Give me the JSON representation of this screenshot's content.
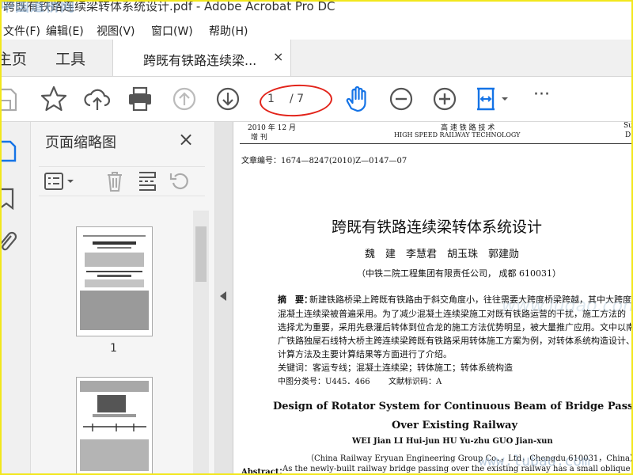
{
  "window": {
    "title": "跨既有铁路连续梁转体系统设计.pdf - Adobe Acrobat Pro DC"
  },
  "watermarks": {
    "top_left": "中国道桥网",
    "bottom_right": "www.lubao.com",
    "middle": "www.ludao.com"
  },
  "menu": [
    "文件(F)",
    "编辑(E)",
    "视图(V)",
    "窗口(W)",
    "帮助(H)"
  ],
  "tabs": {
    "home": "主页",
    "tools": "工具",
    "document": "跨既有铁路连续梁...",
    "close": "×"
  },
  "toolbar": {
    "page_current": "1",
    "page_total": "/ 7",
    "more": "···"
  },
  "thumbnails": {
    "header": "页面缩略图",
    "close": "×",
    "page1_label": "1"
  },
  "document": {
    "header_left_1": "2010 年 12 月",
    "header_left_2": "增  刊",
    "header_center_1": "高  速  铁  路  技  术",
    "header_center_2": "HIGH SPEED RAILWAY TECHNOLOGY",
    "header_right_1": "Su",
    "header_right_2": "D",
    "article_no": "文章编号：1674—8247(2010)Z—0147—07",
    "title_cn": "跨既有铁路连续梁转体系统设计",
    "authors_cn": "魏　建　李慧君　胡玉珠　郭建勋",
    "affiliation_cn": "（中铁二院工程集团有限责任公司，  成都 610031）",
    "abstract_label": "摘　要：",
    "abstract_lines": [
      "新建铁路桥梁上跨既有铁路由于斜交角度小，往往需要大跨度桥梁跨越，其中大跨度",
      "混凝土连续梁被普遍采用。为了减少混凝土连续梁施工对既有铁路运营的干扰，施工方法的",
      "选择尤为重要，采用先悬灌后转体到位合龙的施工方法优势明显，被大量推广应用。文中以南",
      "广铁路独屋石线特大桥主跨连续梁跨既有铁路采用转体施工方案为例，对转体系统构造设计、",
      "计算方法及主要计算结果等方面进行了介绍。"
    ],
    "keywords": "关键词：客运专线；混凝土连续梁；转体施工；转体系统构造",
    "clc": "中图分类号：U445．466",
    "doc_code": "文献标识码：A",
    "title_en_1": "Design of Rotator System for Continuous Beam of Bridge Passing",
    "title_en_2": "Over Existing Railway",
    "authors_en": "WEI Jian   LI Hui-jun   HU Yu-zhu   GUO Jian-xun",
    "affiliation_en": "（China Railway Eryuan Engineering Group Co．，Ltd，Chengdu   610031，China）",
    "abstract_en_label": "Abstract：",
    "abstract_en": "As the newly-built railway bridge passing over the existing railway has a small oblique crossing angle,"
  }
}
